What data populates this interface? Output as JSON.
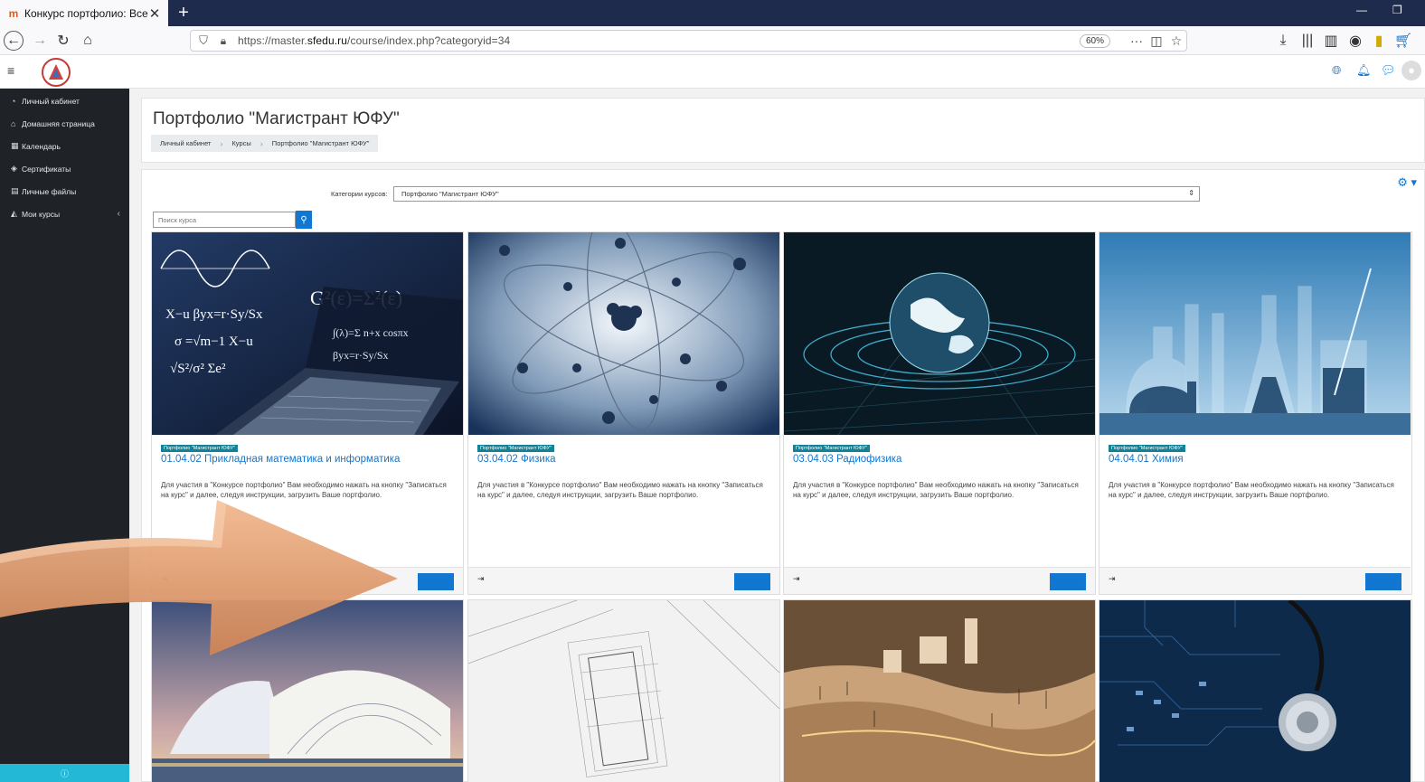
{
  "browser": {
    "tab_title": "Конкурс портфолио: Все курс",
    "url_host_pre": "https://master.",
    "url_host_main": "sfedu.ru",
    "url_path": "/course/index.php?categoryid=34",
    "zoom": "60%"
  },
  "sidebar": {
    "items": [
      {
        "label": "Личный кабинет",
        "icon": "dashboard-icon"
      },
      {
        "label": "Домашняя страница",
        "icon": "home-icon"
      },
      {
        "label": "Календарь",
        "icon": "calendar-icon"
      },
      {
        "label": "Сертификаты",
        "icon": "certificate-icon"
      },
      {
        "label": "Личные файлы",
        "icon": "file-icon"
      },
      {
        "label": "Мои курсы",
        "icon": "graduation-cap-icon"
      }
    ]
  },
  "page": {
    "title": "Портфолио \"Магистрант ЮФУ\"",
    "breadcrumb": [
      "Личный кабинет",
      "Курсы",
      "Портфолио \"Магистрант ЮФУ\""
    ]
  },
  "filters": {
    "category_label": "Категории курсов:",
    "category_value": "Портфолио \"Магистрант ЮФУ\"",
    "search_placeholder": "Поиск курса"
  },
  "courses": [
    {
      "badge": "Портфолио \"Магистрант ЮФУ\"",
      "title": "01.04.02 Прикладная математика и информатика",
      "description": "Для участия в \"Конкурсе портфолио\" Вам необходимо нажать на кнопку \"Записаться на курс\" и далее, следуя инструкции, загрузить Ваше портфолио.",
      "button": "Подробнее"
    },
    {
      "badge": "Портфолио \"Магистрант ЮФУ\"",
      "title": "03.04.02 Физика",
      "description": "Для участия в \"Конкурсе портфолио\" Вам необходимо нажать на кнопку \"Записаться на курс\" и далее, следуя инструкции, загрузить Ваше портфолио.",
      "button": "Подробнее"
    },
    {
      "badge": "Портфолио \"Магистрант ЮФУ\"",
      "title": "03.04.03 Радиофизика",
      "description": "Для участия в \"Конкурсе портфолио\" Вам необходимо нажать на кнопку \"Записаться на курс\" и далее, следуя инструкции, загрузить Ваше портфолио.",
      "button": "Подробнее"
    },
    {
      "badge": "Портфолио \"Магистрант ЮФУ\"",
      "title": "04.04.01 Химия",
      "description": "Для участия в \"Конкурсе портфолио\" Вам необходимо нажать на кнопку \"Записаться на курс\" и далее, следуя инструкции, загрузить Ваше портфолио.",
      "button": "Подробнее"
    }
  ],
  "colors": {
    "accent": "#1177d1",
    "badge": "#148296",
    "sidebar": "#1f2328",
    "tabbar": "#1f2b4c",
    "arrow": "#e8a47c"
  }
}
